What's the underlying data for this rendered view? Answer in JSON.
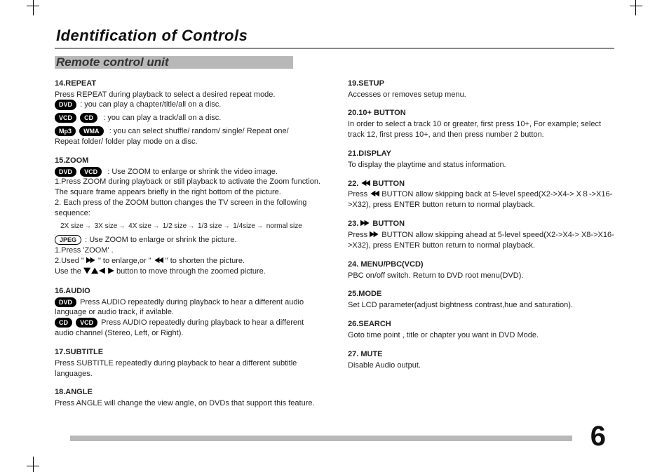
{
  "title": "Identification of Controls",
  "subtitle": "Remote control unit",
  "page_number": "6",
  "left": {
    "s14": {
      "h": "14.REPEAT",
      "intro": "Press REPEAT during playback to select a desired repeat mode.",
      "dvd": ": you can play a chapter/title/all on a disc.",
      "vcd_cd": ": you can play a track/all on a disc.",
      "mp3_wma": ": you can select shuffle/ random/ single/ Repeat one/",
      "tail": "Repeat folder/ folder play mode on a disc."
    },
    "s15": {
      "h": "15.ZOOM",
      "dvd_vcd": ": Use ZOOM to enlarge or shrink the video image.",
      "p1": "1.Press ZOOM during playback or still playback to activate the Zoom function. The square frame appears briefly in the right bottom of the picture.",
      "p2": "2. Each press of the ZOOM button changes the TV screen in the following sequence:",
      "seq": [
        "2X size",
        "3X size",
        "4X size",
        "1/2 size",
        "1/3 size",
        "1/4size",
        "normal size"
      ],
      "jpeg": ": Use ZOOM to enlarge or shrink the picture.",
      "j1": "1.Press 'ZOOM' .",
      "j2a": "2.Used \" ",
      "j2b": " \" to enlarge,or \" ",
      "j2c": " \" to shorten the picture.",
      "j3a": "Use the ",
      "j3b": " button to move through the zoomed picture."
    },
    "s16": {
      "h": "16.AUDIO",
      "dvd": "Press AUDIO repeatedly during playback to hear a different audio language or audio track, if avilable.",
      "cd_vcd": "Press AUDIO repeatedly during playback to hear a different audio channel (Stereo, Left, or Right)."
    },
    "s17": {
      "h": "17.SUBTITLE",
      "p": "Press SUBTITLE repeatedly during playback to hear a different subtitle languages."
    },
    "s18": {
      "h": "18.ANGLE",
      "p": "Press ANGLE will change the view angle, on DVDs that support this feature."
    }
  },
  "right": {
    "s19": {
      "h": "19.SETUP",
      "p": "Accesses or removes setup menu."
    },
    "s20": {
      "h": "20.10+ BUTTON",
      "p": "In order to select a track 10 or greater, first press 10+, For example; select track 12, first press 10+, and then press number 2 button."
    },
    "s21": {
      "h": "21.DISPLAY",
      "p": "To display the playtime and status information."
    },
    "s22": {
      "h_pre": "22. ",
      "h_post": " BUTTON",
      "pre": "Press ",
      "post": " BUTTON allow skipping back at 5-level speed(X2->X4-> X８->X16->X32), press ENTER button return to normal playback."
    },
    "s23": {
      "h_pre": "23. ",
      "h_post": " BUTTON",
      "pre": "Press ",
      "post": " BUTTON allow skipping ahead at 5-level speed(X2->X4-> X8->X16->X32), press ENTER button return to normal playback."
    },
    "s24": {
      "h": "24. MENU/PBC(VCD)",
      "p": "PBC on/off switch. Return to DVD root menu(DVD)."
    },
    "s25": {
      "h": "25.MODE",
      "p": "Set LCD parameter(adjust bightness contrast,hue and saturation)."
    },
    "s26": {
      "h": "26.SEARCH",
      "p": "Goto time point , title or chapter you want in DVD Mode."
    },
    "s27": {
      "h": "27. MUTE",
      "p": "Disable Audio output."
    }
  },
  "labels": {
    "dvd": "DVD",
    "vcd": "VCD",
    "cd": "CD",
    "mp3": "Mp3",
    "wma": "WMA",
    "jpeg": "JPEG"
  }
}
